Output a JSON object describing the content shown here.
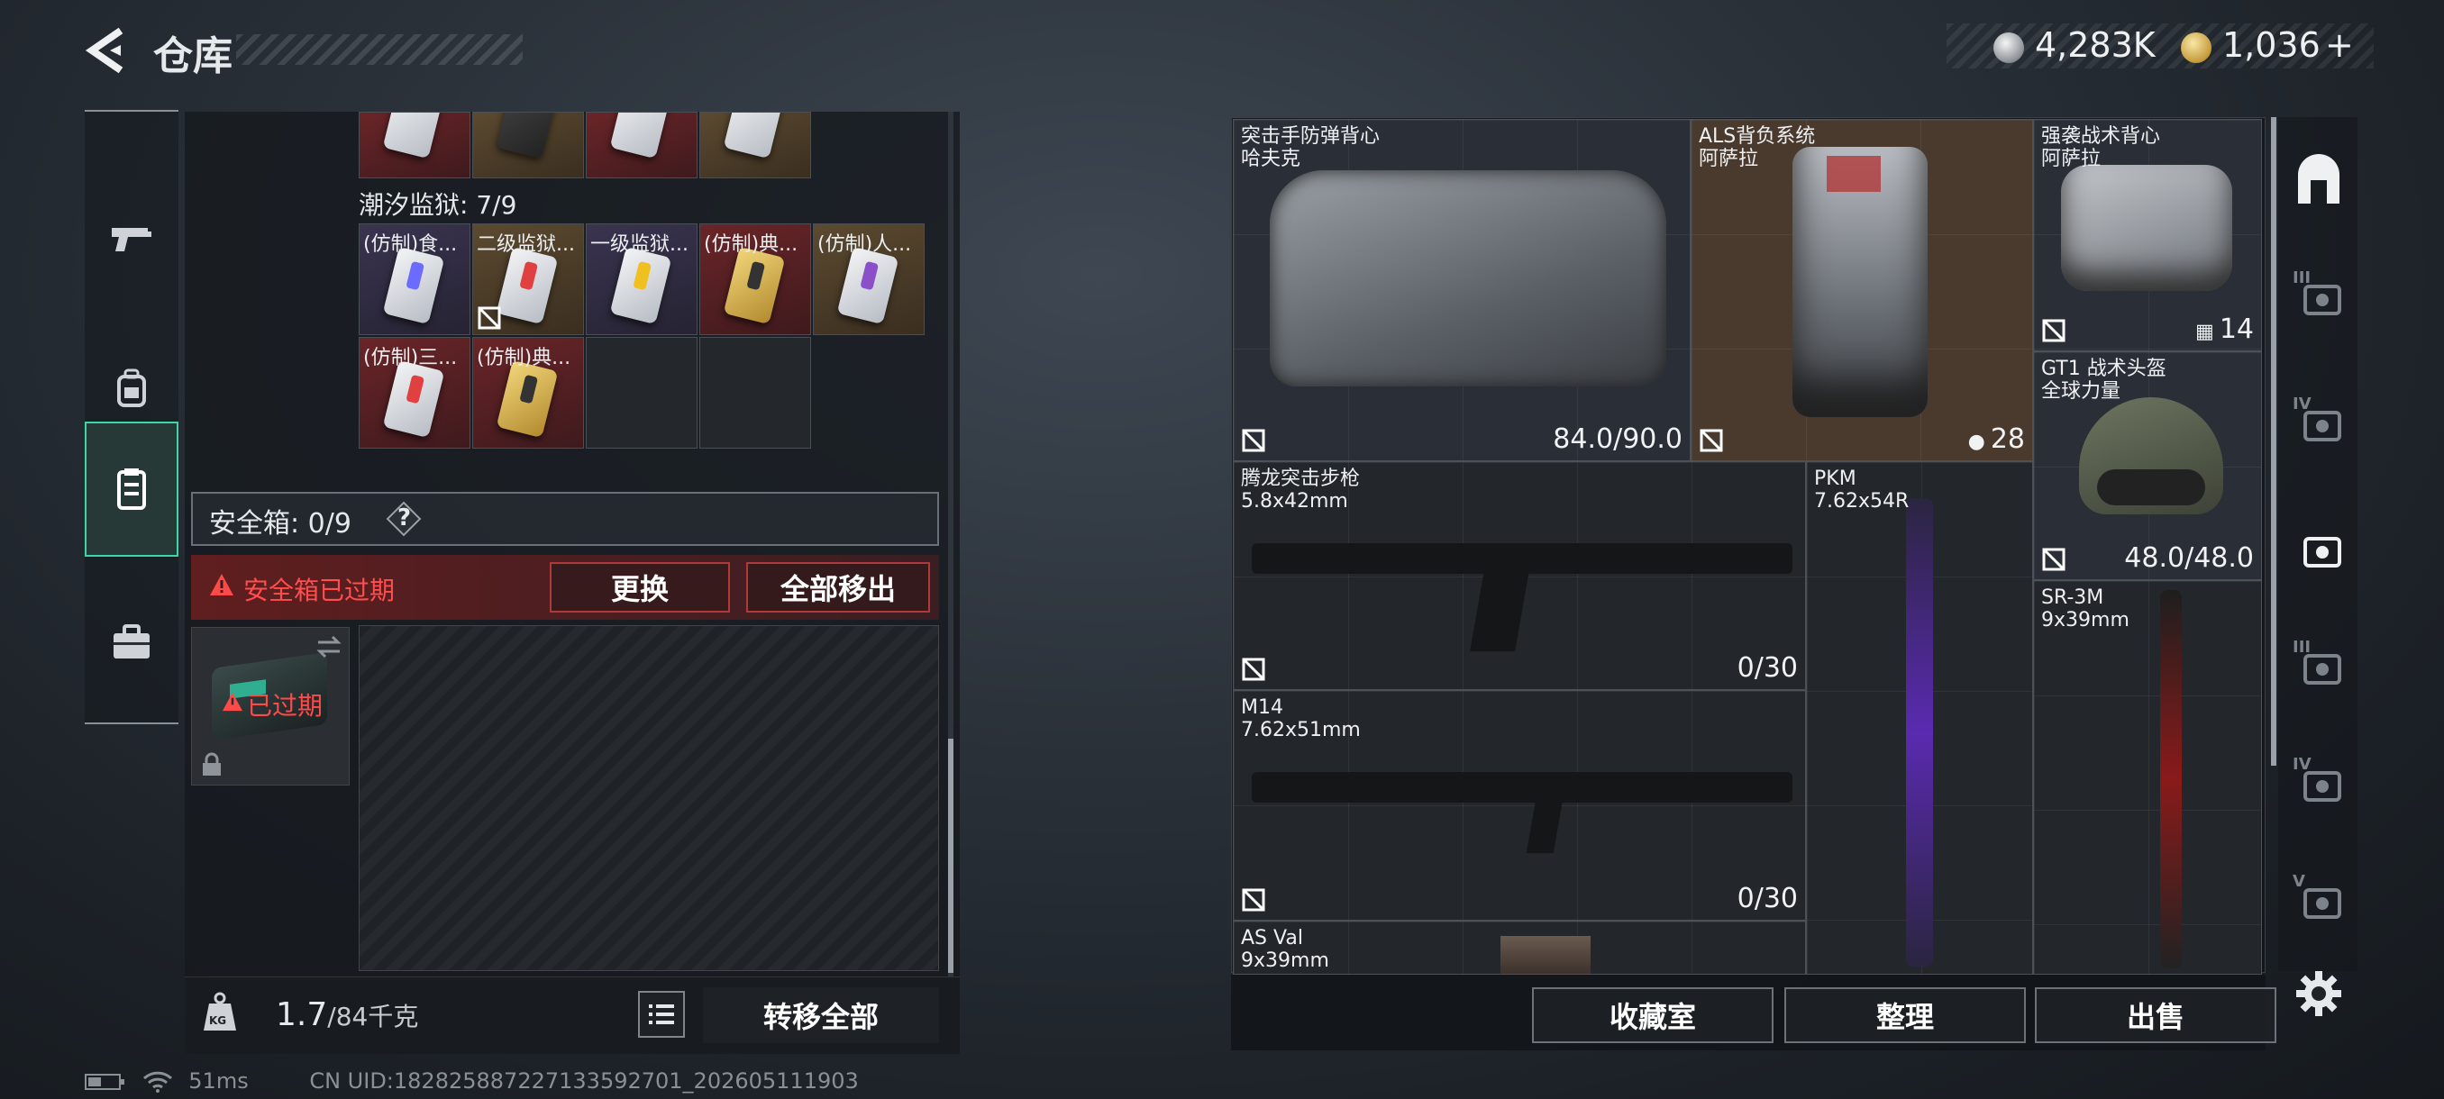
{
  "header": {
    "title": "仓库",
    "back_icon": "back-arrow-icon"
  },
  "currency": [
    {
      "icon": "silver-coin-icon",
      "value": "4,283K",
      "color": "#c9ccd0"
    },
    {
      "icon": "gold-coin-icon",
      "value": "1,036",
      "add": "+",
      "color": "#d6b35a"
    }
  ],
  "left_nav": [
    {
      "icon": "gun-icon",
      "selected": false
    },
    {
      "icon": "backpack-icon",
      "selected": false
    },
    {
      "icon": "vest-icon",
      "selected": true
    },
    {
      "icon": "case-icon",
      "selected": false
    }
  ],
  "container": {
    "label": "潮汐监狱: 7/9",
    "items": [
      {
        "label": "(仿制)食...",
        "style": "purp",
        "strip": "#6b6bff",
        "gold": false,
        "locked": false
      },
      {
        "label": "二级监狱...",
        "style": "gold",
        "strip": "#e04040",
        "gold": false,
        "locked": true
      },
      {
        "label": "一级监狱...",
        "style": "purp",
        "strip": "#f0c020",
        "gold": false,
        "locked": false
      },
      {
        "label": "(仿制)典...",
        "style": "red",
        "strip": "#333",
        "gold": true,
        "locked": false
      },
      {
        "label": "(仿制)人...",
        "style": "gold",
        "strip": "#8b4fc9",
        "gold": false,
        "locked": false
      },
      {
        "label": "(仿制)三...",
        "style": "red",
        "strip": "#e04040",
        "gold": false,
        "locked": false
      },
      {
        "label": "(仿制)典...",
        "style": "red",
        "strip": "#333",
        "gold": true,
        "locked": false
      }
    ]
  },
  "safe_box": {
    "label": "安全箱: 0/9",
    "help": "?",
    "expired_msg": "安全箱已过期",
    "replace_label": "更换",
    "remove_all_label": "全部移出",
    "case_expired": "已过期"
  },
  "footer_left": {
    "weight": "1.7",
    "weight_max": "/84千克",
    "weight_icon": "KG",
    "transfer_all_label": "转移全部"
  },
  "status": {
    "ping": "51ms",
    "uid": "CN UID:182825887227133592701_202605111903"
  },
  "stash": [
    {
      "name": "突击手防弹背心",
      "sub": "哈夫克",
      "value": "84.0/90.0",
      "bg": "#2a2e36"
    },
    {
      "name": "ALS背负系统",
      "sub": "阿萨拉",
      "value": "28",
      "bg": "#4a3a2d"
    },
    {
      "name": "强袭战术背心",
      "sub": "阿萨拉",
      "value": "14",
      "bg": "#2a2e36"
    },
    {
      "name": "GT1 战术头盔",
      "sub": "全球力量",
      "value": "48.0/48.0",
      "bg": "#2a2e36"
    },
    {
      "name": "腾龙突击步枪",
      "sub": "5.8x42mm",
      "value": "0/30",
      "bg": "#23272c"
    },
    {
      "name": "PKM",
      "sub": "7.62x54R",
      "value": "",
      "bg": "#23272c"
    },
    {
      "name": "SR-3M",
      "sub": "9x39mm",
      "value": "",
      "bg": "#23272c"
    },
    {
      "name": "M14",
      "sub": "7.62x51mm",
      "value": "0/30",
      "bg": "#23272c"
    },
    {
      "name": "AS Val",
      "sub": "9x39mm",
      "value": "",
      "bg": "#23272c"
    }
  ],
  "right_bar": [
    {
      "icon": "helmet-slot-icon",
      "roman": ""
    },
    {
      "icon": "vest-slot-icon",
      "roman": "III"
    },
    {
      "icon": "folder-slot-icon",
      "roman": "IV"
    },
    {
      "icon": "gti-slot-icon",
      "roman": ""
    },
    {
      "icon": "tool-slot-icon",
      "roman": "III"
    },
    {
      "icon": "keycard-slot-icon",
      "roman": "IV"
    },
    {
      "icon": "device-slot-icon",
      "roman": "V"
    }
  ],
  "footer_right": {
    "collection_label": "收藏室",
    "sort_label": "整理",
    "sell_label": "出售"
  }
}
